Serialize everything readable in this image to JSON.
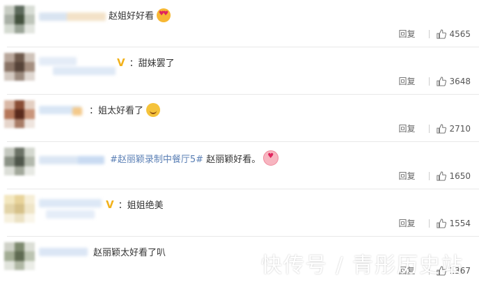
{
  "comments": [
    {
      "text": "赵姐好好看",
      "reply": "回复",
      "likes": "4565",
      "emoji": "heart-eyes"
    },
    {
      "text": "：甜妹罢了",
      "reply": "回复",
      "likes": "3648"
    },
    {
      "text": "：姐太好看了",
      "reply": "回复",
      "likes": "2710",
      "emoji": "smile"
    },
    {
      "hashtag": "#赵丽颖录制中餐厅5#",
      "text": " 赵丽颖好看。",
      "reply": "回复",
      "likes": "1650",
      "emoji": "kiss"
    },
    {
      "text": "：姐姐绝美",
      "reply": "回复",
      "likes": "1554"
    },
    {
      "text": "赵丽颖太好看了叭",
      "reply": "回复",
      "likes": "1367"
    }
  ],
  "watermark": "快传号 / 青彤历史站",
  "colors": {
    "hashtag": "#5a7fb5",
    "vip": "#f2b21c",
    "divider": "#e8e8e8"
  }
}
